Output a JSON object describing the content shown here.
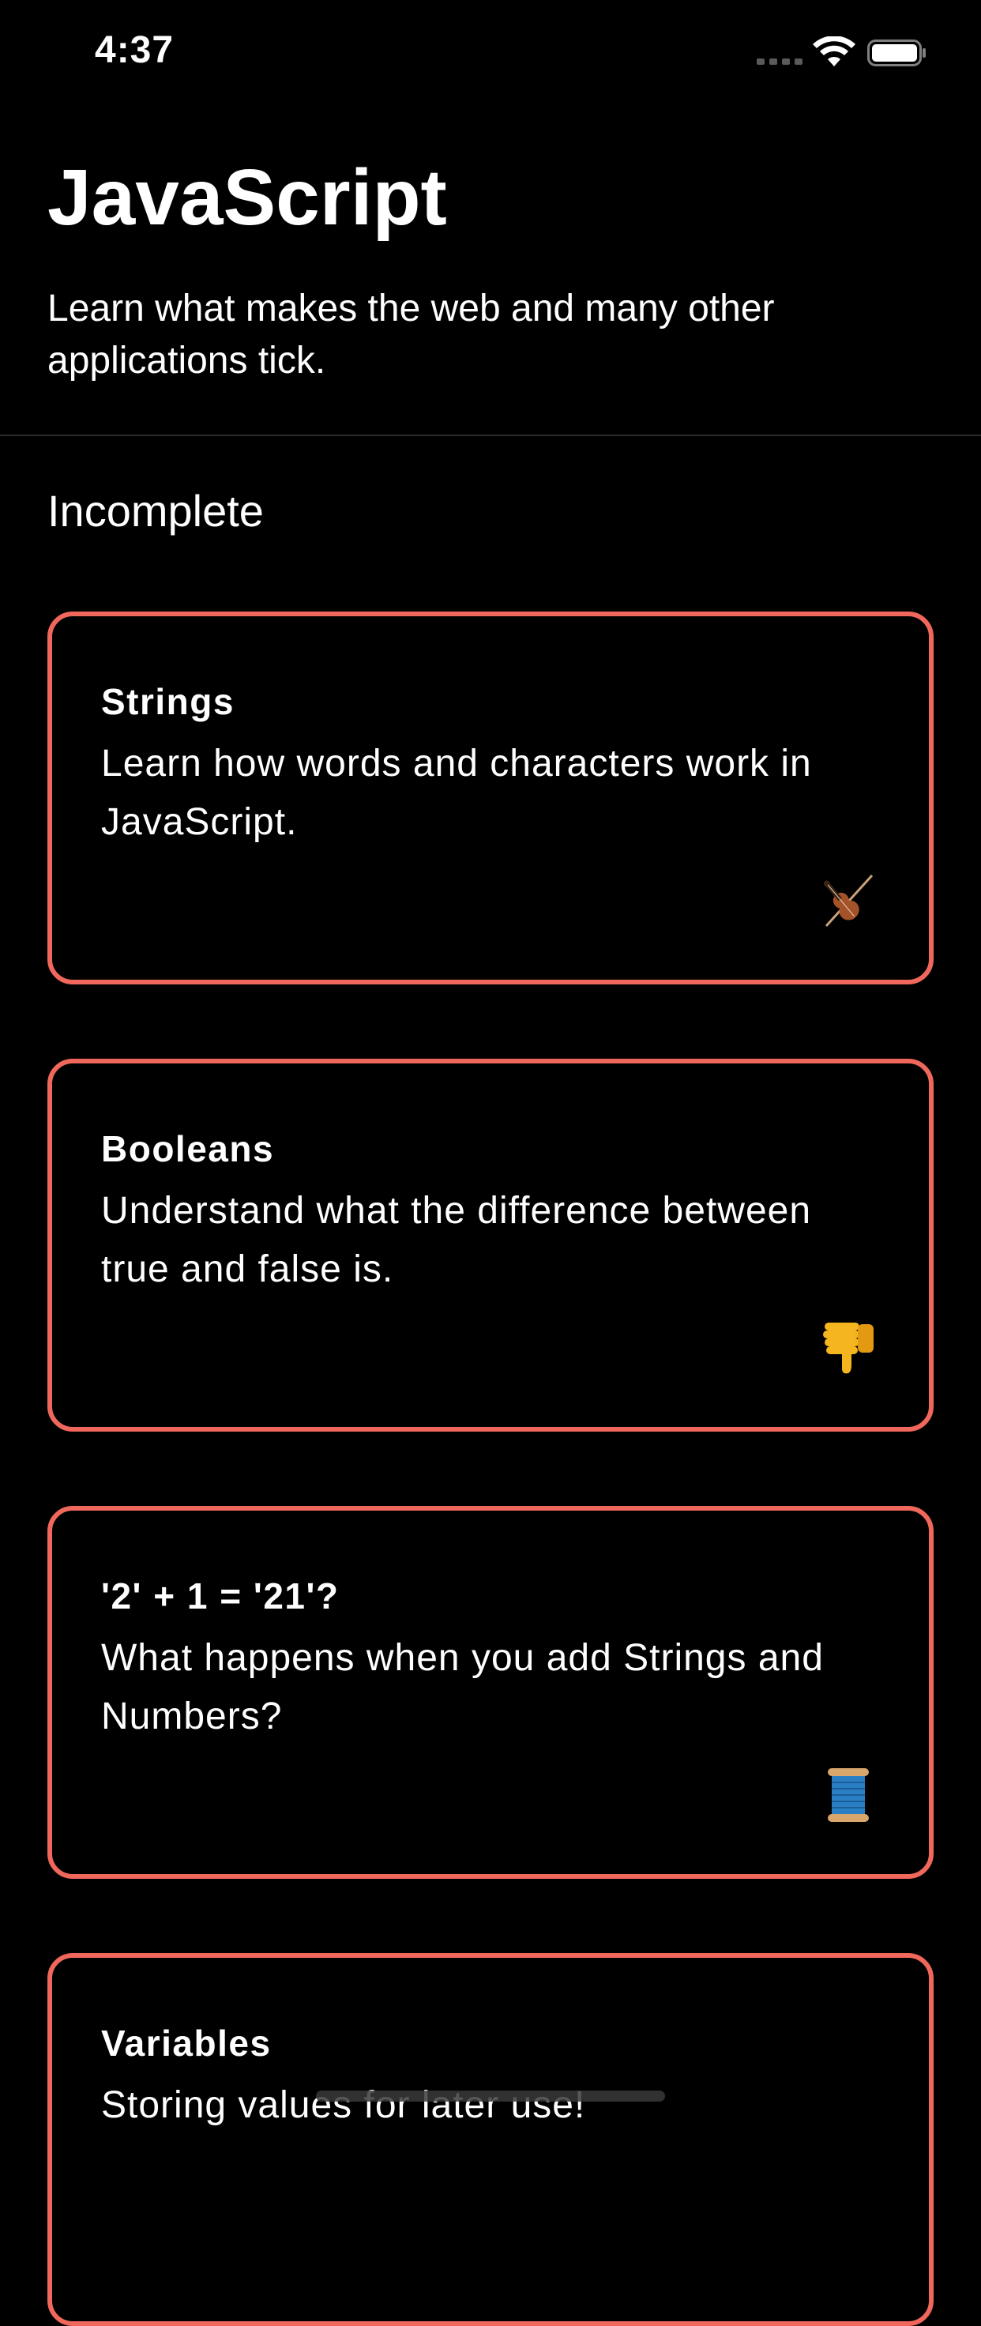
{
  "status_bar": {
    "time": "4:37"
  },
  "header": {
    "title": "JavaScript",
    "subtitle": "Learn what makes the web and many other applications tick."
  },
  "section": {
    "heading": "Incomplete"
  },
  "colors": {
    "accent": "#f0675c",
    "background": "#000000",
    "text": "#ffffff"
  },
  "lessons": [
    {
      "title": "Strings",
      "description": "Learn how words and characters work in JavaScript.",
      "icon": "violin-icon"
    },
    {
      "title": "Booleans",
      "description": "Understand what the difference between true and false is.",
      "icon": "thumbs-down-icon"
    },
    {
      "title": "'2' + 1 = '21'?",
      "description": "What happens when you add Strings and Numbers?",
      "icon": "spool-of-thread-icon"
    },
    {
      "title": "Variables",
      "description": "Storing values for later use!",
      "icon": ""
    }
  ]
}
